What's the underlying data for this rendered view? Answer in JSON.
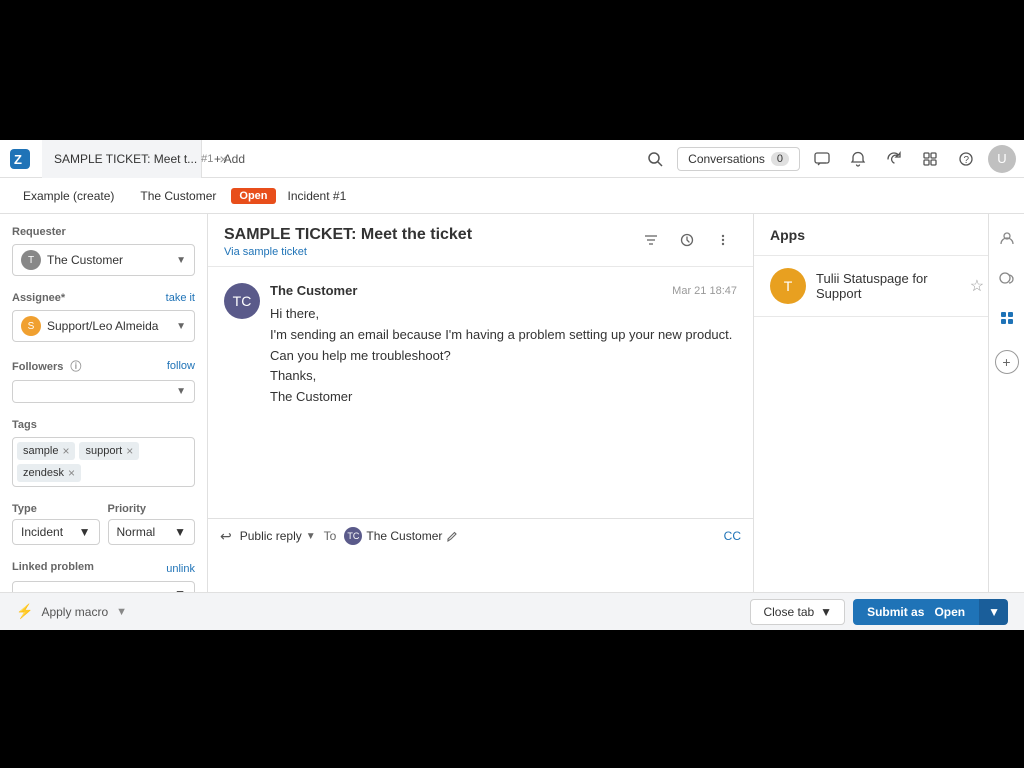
{
  "app": {
    "logo": "Z",
    "tab": {
      "title": "SAMPLE TICKET: Meet t...",
      "subtitle": "#1"
    },
    "add_label": "+ Add"
  },
  "topbar": {
    "conversations_label": "Conversations",
    "conversations_count": "0"
  },
  "breadcrumb": {
    "example": "Example (create)",
    "customer": "The Customer",
    "status": "Open",
    "incident": "Incident #1"
  },
  "sidebar": {
    "requester_label": "Requester",
    "requester_name": "The Customer",
    "assignee_label": "Assignee*",
    "take_it_label": "take it",
    "assignee_name": "Support/Leo Almeida",
    "followers_label": "Followers",
    "follow_label": "follow",
    "tags_label": "Tags",
    "tags": [
      "sample",
      "support",
      "zendesk"
    ],
    "type_label": "Type",
    "type_value": "Incident",
    "priority_label": "Priority",
    "priority_value": "Normal",
    "linked_problem_label": "Linked problem",
    "linked_problem_value": "-",
    "unlink_label": "unlink",
    "apply_macro_label": "Apply macro"
  },
  "ticket": {
    "title": "SAMPLE TICKET: Meet the ticket",
    "subtitle": "Via sample ticket",
    "message": {
      "author": "The Customer",
      "time": "Mar 21 18:47",
      "body_lines": [
        "Hi there,",
        "I'm sending an email because I'm having a problem setting up your new product. Can you help me troubleshoot?",
        "Thanks,",
        "The Customer"
      ]
    },
    "reply": {
      "type": "Public reply",
      "to_label": "To",
      "to_user": "The Customer",
      "cc_label": "CC"
    }
  },
  "apps": {
    "title": "Apps",
    "items": [
      {
        "name": "Tulii Statuspage for Support",
        "icon": "T"
      }
    ]
  },
  "bottom": {
    "close_tab_label": "Close tab",
    "submit_label": "Submit as",
    "submit_status": "Open"
  }
}
